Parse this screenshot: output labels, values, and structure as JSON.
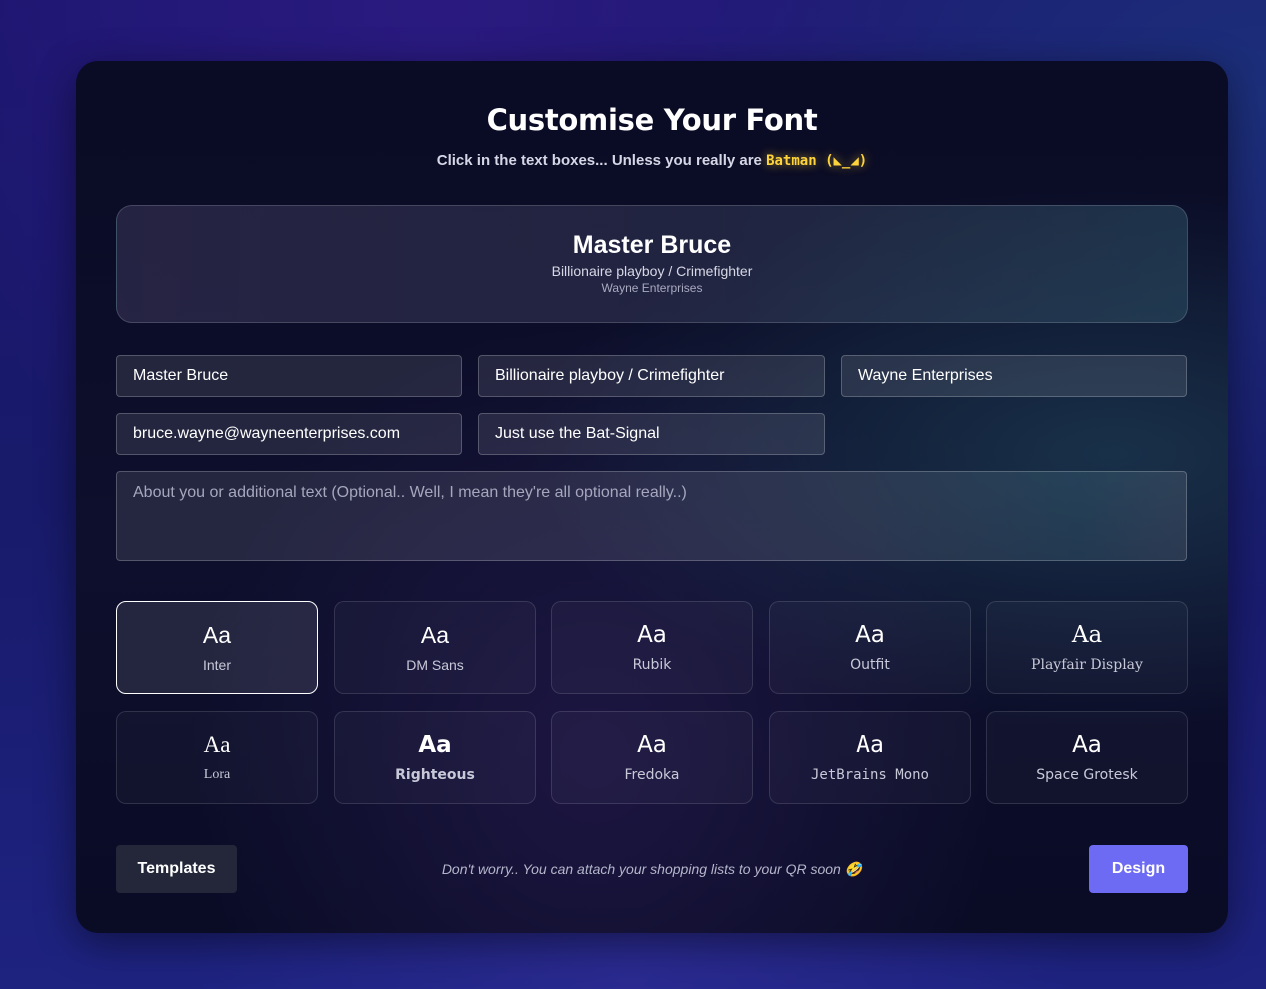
{
  "header": {
    "title": "Customise Your Font",
    "subtitle_prefix": "Click in the text boxes... Unless you really are ",
    "subtitle_highlight": "Batman (◣_◢)"
  },
  "preview": {
    "name": "Master Bruce",
    "title": "Billionaire playboy / Crimefighter",
    "organization": "Wayne Enterprises"
  },
  "fields": {
    "name": "Master Bruce",
    "title": "Billionaire playboy / Crimefighter",
    "organization": "Wayne Enterprises",
    "email": "bruce.wayne@wayneenterprises.com",
    "phone": "Just use the Bat-Signal",
    "about_placeholder": "About you or additional text (Optional.. Well, I mean they're all optional really..)"
  },
  "fonts": {
    "sample": "Aa",
    "selected": "Inter",
    "options": [
      {
        "name": "Inter"
      },
      {
        "name": "DM Sans"
      },
      {
        "name": "Rubik"
      },
      {
        "name": "Outfit"
      },
      {
        "name": "Playfair Display"
      },
      {
        "name": "Lora"
      },
      {
        "name": "Righteous"
      },
      {
        "name": "Fredoka"
      },
      {
        "name": "JetBrains Mono"
      },
      {
        "name": "Space Grotesk"
      }
    ]
  },
  "footer": {
    "templates_label": "Templates",
    "note": "Don't worry.. You can attach your shopping lists to your QR soon 🤣",
    "design_label": "Design"
  },
  "colors": {
    "accent": "#6d6af3",
    "highlight": "#ffd43b"
  }
}
